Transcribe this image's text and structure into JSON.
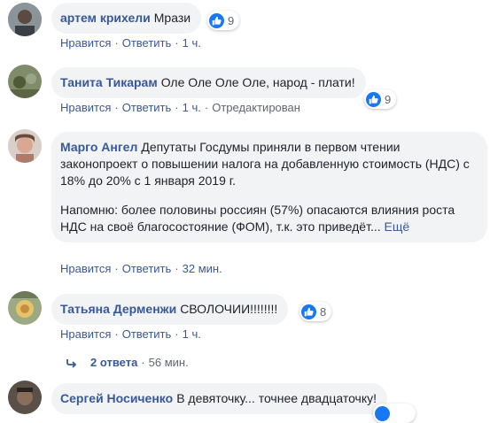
{
  "comments": [
    {
      "author": "артем крихели",
      "paragraphs": [
        "Мрази"
      ],
      "reactions": "9",
      "like_label": "Нравится",
      "reply_label": "Ответить",
      "time": "1 ч.",
      "avatar_color": "#7a8a8f"
    },
    {
      "author": "Танита Тикарам",
      "paragraphs": [
        "Оле Оле Оле Оле, народ - плати!"
      ],
      "reactions": "9",
      "like_label": "Нравится",
      "reply_label": "Ответить",
      "time": "1 ч.",
      "edited": "Отредактирован",
      "avatar_color": "#6e7d5c"
    },
    {
      "author": "Марго Ангел",
      "paragraphs": [
        "Депутаты Госдумы приняли в первом чтении законопроект о повышении налога на добавленную стоимость (НДС) с 18% до 20% с 1 января 2019 г.",
        "Напомню: более половины россиян (57%) опасаются влияния роста НДС на своё благосостояние (ФОМ), т.к. это приведёт..."
      ],
      "more_label": "Ещё",
      "like_label": "Нравится",
      "reply_label": "Ответить",
      "time": "32 мин.",
      "avatar_color": "#c9a08c"
    },
    {
      "author": "Татьяна Дерменжи",
      "paragraphs": [
        "СВОЛОЧИИ!!!!!!!!"
      ],
      "reactions": "8",
      "like_label": "Нравится",
      "reply_label": "Ответить",
      "time": "1 ч.",
      "avatar_color": "#8a9a6e"
    },
    {
      "author": "Сергей Носиченко",
      "paragraphs": [
        "В девяточку... точнее двадцаточку!"
      ],
      "avatar_color": "#4a4038"
    }
  ],
  "replies_link": {
    "label": "2 ответа",
    "time": "56 мин."
  },
  "colors": {
    "link": "#385898",
    "bubble": "#f2f3f5",
    "like": "#1877f2",
    "meta": "#606770"
  }
}
